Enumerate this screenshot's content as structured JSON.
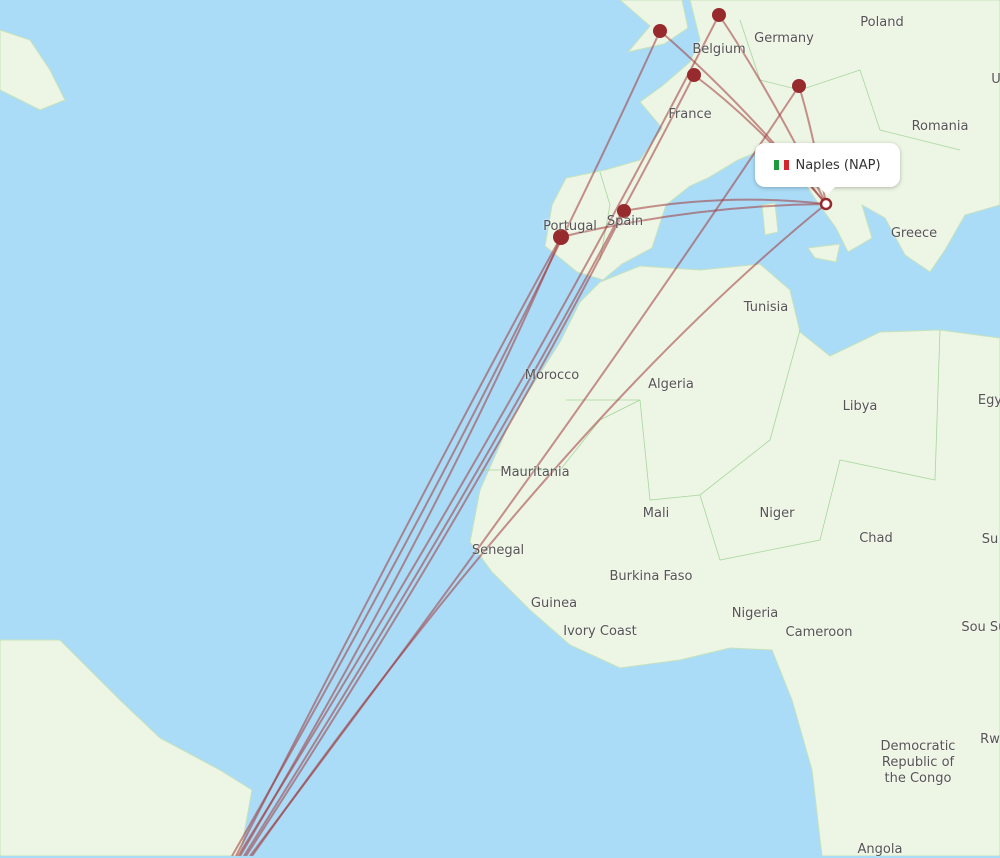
{
  "map": {
    "colors": {
      "sea": "#aadcf7",
      "land": "#edf5e4",
      "border": "#a8d6a0",
      "route": "#a0393c",
      "airport": "#962a2d"
    },
    "tooltip": {
      "label": "Naples (NAP)",
      "flag": "italy-flag",
      "flag_colors": [
        "#1f9a3c",
        "#f4f4f4",
        "#d2262f"
      ]
    },
    "labels": [
      {
        "text": "Poland"
      },
      {
        "text": "Germany"
      },
      {
        "text": "Belgium"
      },
      {
        "text": "France"
      },
      {
        "text": "Romania"
      },
      {
        "text": "Portugal"
      },
      {
        "text": "Spain"
      },
      {
        "text": "Greece"
      },
      {
        "text": "Tunisia"
      },
      {
        "text": "Morocco"
      },
      {
        "text": "Algeria"
      },
      {
        "text": "Libya"
      },
      {
        "text": "Egy"
      },
      {
        "text": "Mauritania"
      },
      {
        "text": "Mali"
      },
      {
        "text": "Niger"
      },
      {
        "text": "Chad"
      },
      {
        "text": "Su"
      },
      {
        "text": "Senegal"
      },
      {
        "text": "Burkina Faso"
      },
      {
        "text": "Guinea"
      },
      {
        "text": "Ivory Coast"
      },
      {
        "text": "Nigeria"
      },
      {
        "text": "Cameroon"
      },
      {
        "text": "Democratic Republic of the Congo"
      },
      {
        "text": "Rw"
      },
      {
        "text": "Sou Sud"
      },
      {
        "text": "Angola"
      },
      {
        "text": "U"
      }
    ]
  }
}
